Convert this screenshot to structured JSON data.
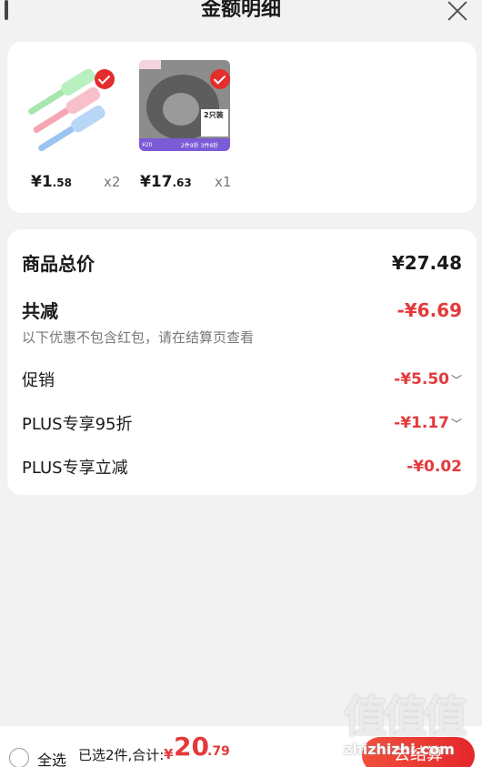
{
  "header": {
    "title": "金额明细"
  },
  "products": [
    {
      "price_int": "¥1",
      "price_dec": ".58",
      "qty": "x2"
    },
    {
      "price_int": "¥17",
      "price_dec": ".63",
      "qty": "x1",
      "badge_line1": "2只装",
      "badge_line2": "2件9折 3件8折",
      "badge_line3": "¥20"
    }
  ],
  "summary": {
    "total_label": "商品总价",
    "total_value": "¥27.48",
    "discount_label": "共减",
    "discount_value": "-¥6.69",
    "note": "以下优惠不包含红包，请在结算页查看",
    "items": [
      {
        "label": "促销",
        "value": "-¥5.50"
      },
      {
        "label": "PLUS专享95折",
        "value": "-¥1.17"
      },
      {
        "label": "PLUS专享立减",
        "value": "-¥0.02"
      }
    ]
  },
  "bottom_bar": {
    "select_all": "全选",
    "selected_text": "已选2件,合计:",
    "currency": "¥",
    "total_int": "20",
    "total_dec": ".79",
    "checkout_label": "去结算"
  },
  "watermark": {
    "logo": "值值值",
    "text": "zhizhizhi.com"
  },
  "colors": {
    "accent": "#e4393c",
    "background": "#f2f2f2"
  }
}
